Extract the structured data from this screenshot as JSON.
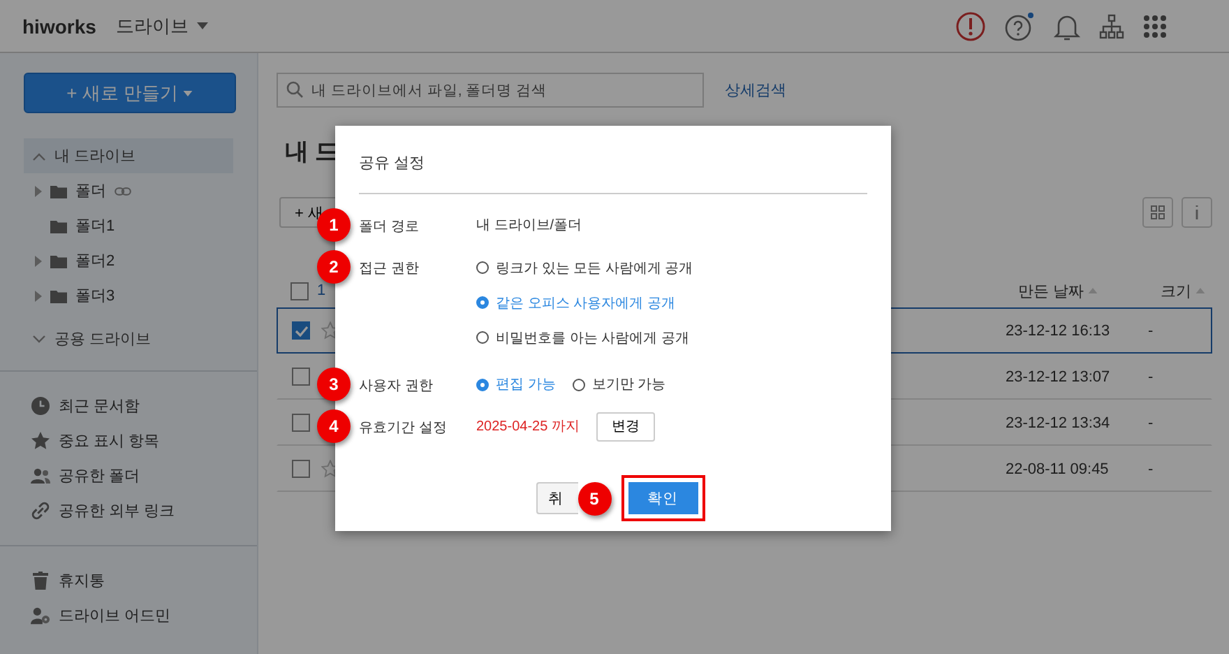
{
  "header": {
    "logo": "hiworks",
    "app": "드라이브"
  },
  "sidebar": {
    "new_button": "+ 새로 만들기",
    "tree": [
      {
        "label": "내 드라이브",
        "expanded": true,
        "selected": true,
        "children": [
          {
            "label": "폴더",
            "has_children": true,
            "link": true
          },
          {
            "label": "폴더1",
            "has_children": false,
            "link": false
          },
          {
            "label": "폴더2",
            "has_children": true,
            "link": false
          },
          {
            "label": "폴더3",
            "has_children": true,
            "link": false
          }
        ]
      },
      {
        "label": "공용 드라이브",
        "expanded": false,
        "selected": false
      }
    ],
    "menu_groups": [
      [
        {
          "label": "최근 문서함",
          "kind": "recent"
        },
        {
          "label": "중요 표시 항목",
          "kind": "starred"
        },
        {
          "label": "공유한 폴더",
          "kind": "shared-folder"
        },
        {
          "label": "공유한 외부 링크",
          "kind": "shared-link"
        }
      ],
      [
        {
          "label": "휴지통",
          "kind": "trash"
        },
        {
          "label": "드라이브 어드민",
          "kind": "admin"
        }
      ]
    ]
  },
  "main": {
    "search": {
      "placeholder": "내 드라이브에서 파일, 폴더명 검색"
    },
    "detail_search": "상세검색",
    "title": "내 드",
    "new_button": "+ 새",
    "table": {
      "all_checked": false,
      "selected_count": "1",
      "columns": [
        "만든 날짜",
        "크기"
      ],
      "rows": [
        {
          "checked": true,
          "selected": true,
          "starred": false,
          "date": "23-12-12 16:13",
          "size": "-"
        },
        {
          "checked": false,
          "selected": false,
          "date": "23-12-12 13:07",
          "size": "-"
        },
        {
          "checked": false,
          "selected": false,
          "date": "23-12-12 13:34",
          "size": "-"
        },
        {
          "checked": false,
          "selected": false,
          "starred": false,
          "date": "22-08-11 09:45",
          "size": "-"
        }
      ]
    }
  },
  "dialog": {
    "title": "공유 설정",
    "rows": [
      {
        "marker": "1",
        "label": "폴더 경로",
        "kind": "text",
        "value": "내 드라이브/폴더"
      },
      {
        "marker": "2",
        "label": "접근 권한",
        "kind": "radio-list",
        "options": [
          {
            "label": "링크가 있는 모든 사람에게 공개",
            "selected": false
          },
          {
            "label": "같은 오피스 사용자에게 공개",
            "selected": true
          },
          {
            "label": "비밀번호를 아는 사람에게 공개",
            "selected": false
          }
        ]
      },
      {
        "marker": "3",
        "label": "사용자 권한",
        "kind": "radio-inline",
        "options": [
          {
            "label": "편집 가능",
            "selected": true
          },
          {
            "label": "보기만 가능",
            "selected": false
          }
        ]
      },
      {
        "marker": "4",
        "label": "유효기간 설정",
        "kind": "date",
        "value": "2025-04-25 까지",
        "button": "변경"
      }
    ],
    "buttons": [
      {
        "label": "취",
        "kind": "cancel",
        "highlighted": false
      },
      {
        "label": "확인",
        "kind": "confirm",
        "highlighted": true,
        "marker": "5"
      }
    ]
  }
}
